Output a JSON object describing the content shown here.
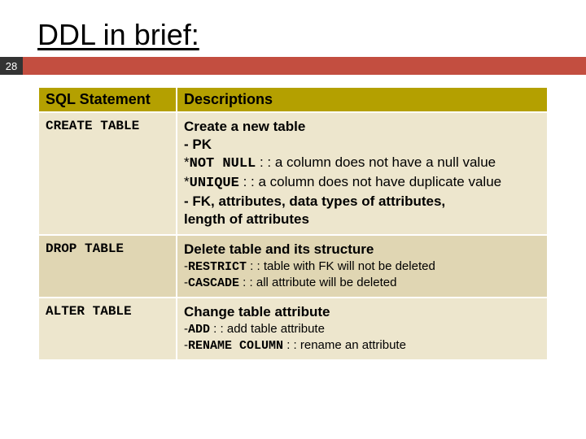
{
  "slide": {
    "title": "DDL in brief:",
    "page_number": "28"
  },
  "table": {
    "headers": {
      "col1": "SQL Statement",
      "col2": "Descriptions"
    },
    "rows": [
      {
        "cmd": "CREATE TABLE",
        "d1": "Create a new table",
        "d2": "- PK",
        "d3a": "  *",
        "d3b": "NOT NULL",
        "d3c": " : : a column does not have a null value",
        "d4a": "  *",
        "d4b": "UNIQUE",
        "d4c": " : : a column does not have duplicate value",
        "d5": "- FK, attributes, data types of attributes,",
        "d6": "  length of attributes"
      },
      {
        "cmd": "DROP TABLE",
        "d1": "Delete table and its structure",
        "d2a": "-",
        "d2b": "RESTRICT",
        "d2c": " : : table with FK will not be deleted",
        "d3a": "-",
        "d3b": "CASCADE",
        "d3c": " : : all attribute will be deleted"
      },
      {
        "cmd": "ALTER TABLE",
        "d1": "Change table attribute",
        "d2a": "-",
        "d2b": "ADD",
        "d2c": " : : add table attribute",
        "d3a": "-",
        "d3b": "RENAME COLUMN",
        "d3c": " : : rename an attribute"
      }
    ]
  }
}
